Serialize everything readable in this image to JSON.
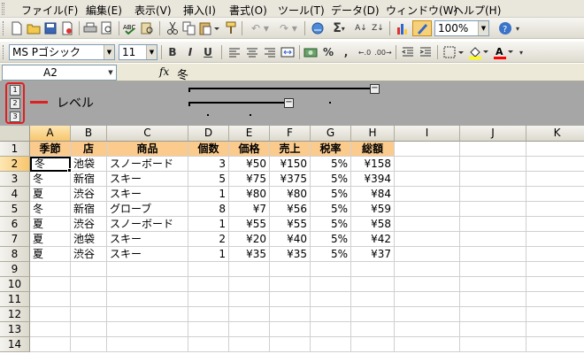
{
  "menu": [
    "ファイル(F)",
    "編集(E)",
    "表示(V)",
    "挿入(I)",
    "書式(O)",
    "ツール(T)",
    "データ(D)",
    "ウィンドウ(W)",
    "ヘルプ(H)"
  ],
  "toolbar": {
    "zoom": "100%",
    "font_name": "MS Pゴシック",
    "font_size": "11",
    "bold": "B",
    "italic": "I",
    "underline": "U",
    "percent": "%",
    "comma": ",",
    "sigma": "Σ"
  },
  "formula_bar": {
    "name_box": "A2",
    "fx": "fx",
    "content": "冬"
  },
  "outline": {
    "levels": [
      "1",
      "2",
      "3"
    ],
    "label": "レベル",
    "collapse_symbol": "−"
  },
  "columns": [
    "A",
    "B",
    "C",
    "D",
    "E",
    "F",
    "G",
    "H",
    "I",
    "J",
    "K"
  ],
  "rows": [
    "1",
    "2",
    "3",
    "4",
    "5",
    "6",
    "7",
    "8",
    "9",
    "10",
    "11",
    "12",
    "13",
    "14"
  ],
  "table": {
    "headers": [
      "季節",
      "店",
      "商品",
      "個数",
      "価格",
      "売上",
      "税率",
      "総額"
    ],
    "data": [
      [
        "冬",
        "池袋",
        "スノーボード",
        "3",
        "¥50",
        "¥150",
        "5%",
        "¥158"
      ],
      [
        "冬",
        "新宿",
        "スキー",
        "5",
        "¥75",
        "¥375",
        "5%",
        "¥394"
      ],
      [
        "夏",
        "渋谷",
        "スキー",
        "1",
        "¥80",
        "¥80",
        "5%",
        "¥84"
      ],
      [
        "冬",
        "新宿",
        "グローブ",
        "8",
        "¥7",
        "¥56",
        "5%",
        "¥59"
      ],
      [
        "夏",
        "渋谷",
        "スノーボード",
        "1",
        "¥55",
        "¥55",
        "5%",
        "¥58"
      ],
      [
        "夏",
        "池袋",
        "スキー",
        "2",
        "¥20",
        "¥40",
        "5%",
        "¥42"
      ],
      [
        "夏",
        "渋谷",
        "スキー",
        "1",
        "¥35",
        "¥35",
        "5%",
        "¥37"
      ]
    ]
  },
  "active_cell": "A2",
  "colors": {
    "header_fill": "#fbcb8e",
    "selection_header": "#f7c66d",
    "outline_bg": "#a6a6a6",
    "annotation": "#e02020"
  }
}
